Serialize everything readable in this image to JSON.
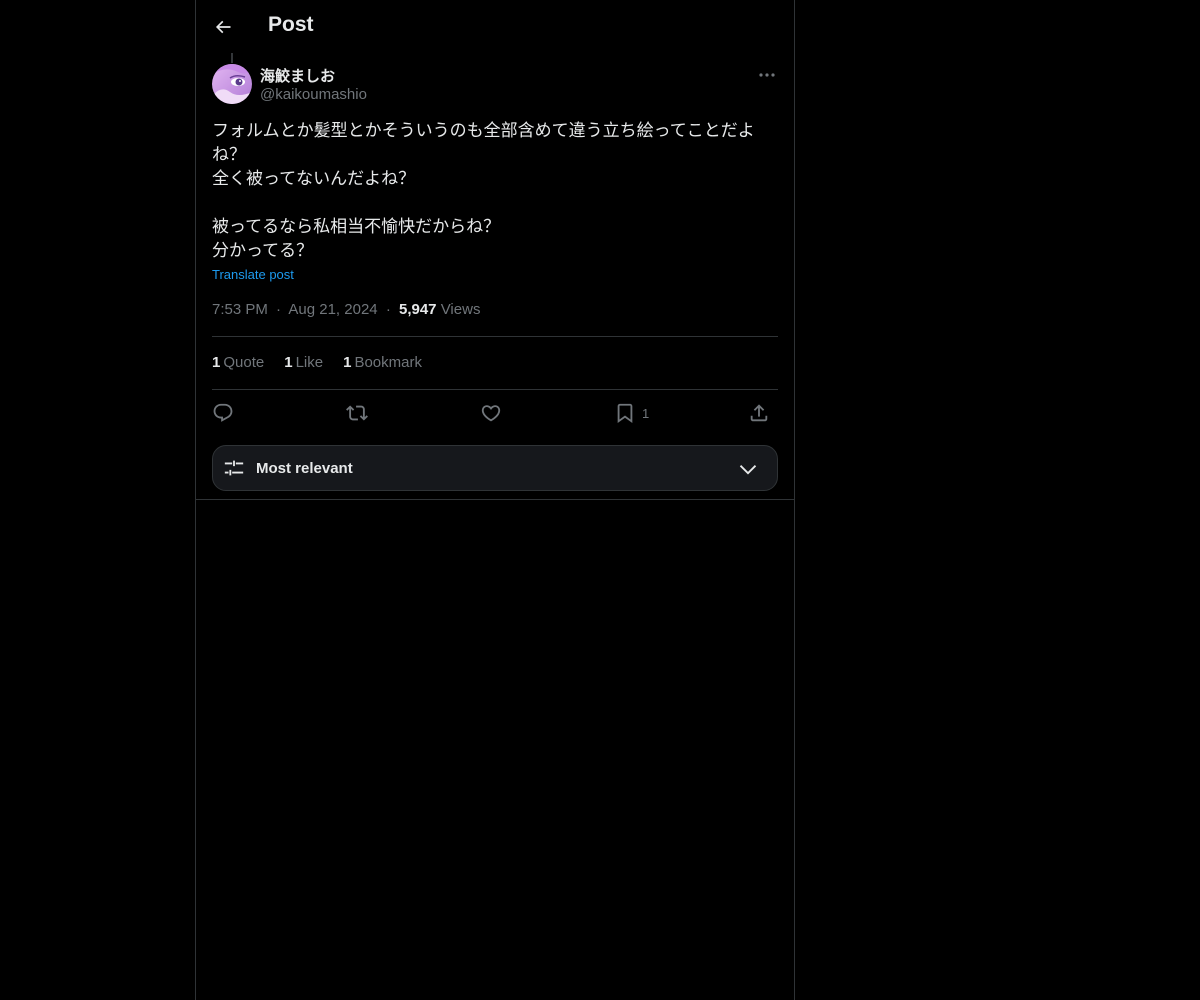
{
  "header": {
    "title": "Post",
    "back_icon": "arrow-left-icon"
  },
  "author": {
    "name": "海鮫ましお",
    "handle": "@kaikoumashio",
    "avatar_icon": "avatar-image",
    "more_icon": "more-horizontal-icon"
  },
  "post": {
    "lines": [
      "フォルムとか髪型とかそういうのも全部含めて違う立ち絵ってことだよ",
      "ね？",
      "全く被ってないんだよね？",
      "",
      "被ってるなら私相当不愉快だからね？",
      "分かってる？"
    ],
    "translate_label": "Translate post",
    "time": "7:53 PM",
    "date": "Aug 21, 2024",
    "separator": "·",
    "views_count": "5,947",
    "views_label": "Views"
  },
  "stats": {
    "quotes_count": "1",
    "quotes_label": "Quote",
    "likes_count": "1",
    "likes_label": "Like",
    "bookmarks_count": "1",
    "bookmarks_label": "Bookmark"
  },
  "actions": {
    "reply_icon": "reply-icon",
    "repost_icon": "repost-icon",
    "like_icon": "heart-icon",
    "bookmark_icon": "bookmark-icon",
    "bookmark_count": "1",
    "share_icon": "share-icon"
  },
  "sort": {
    "label": "Most relevant",
    "icon": "sliders-icon",
    "chevron": "chevron-down-icon"
  },
  "colors": {
    "background": "#000000",
    "text_primary": "#e7e9ea",
    "text_secondary": "#71767b",
    "accent": "#1d9bf0",
    "border": "#2f3336",
    "sort_bg": "#16181c"
  }
}
